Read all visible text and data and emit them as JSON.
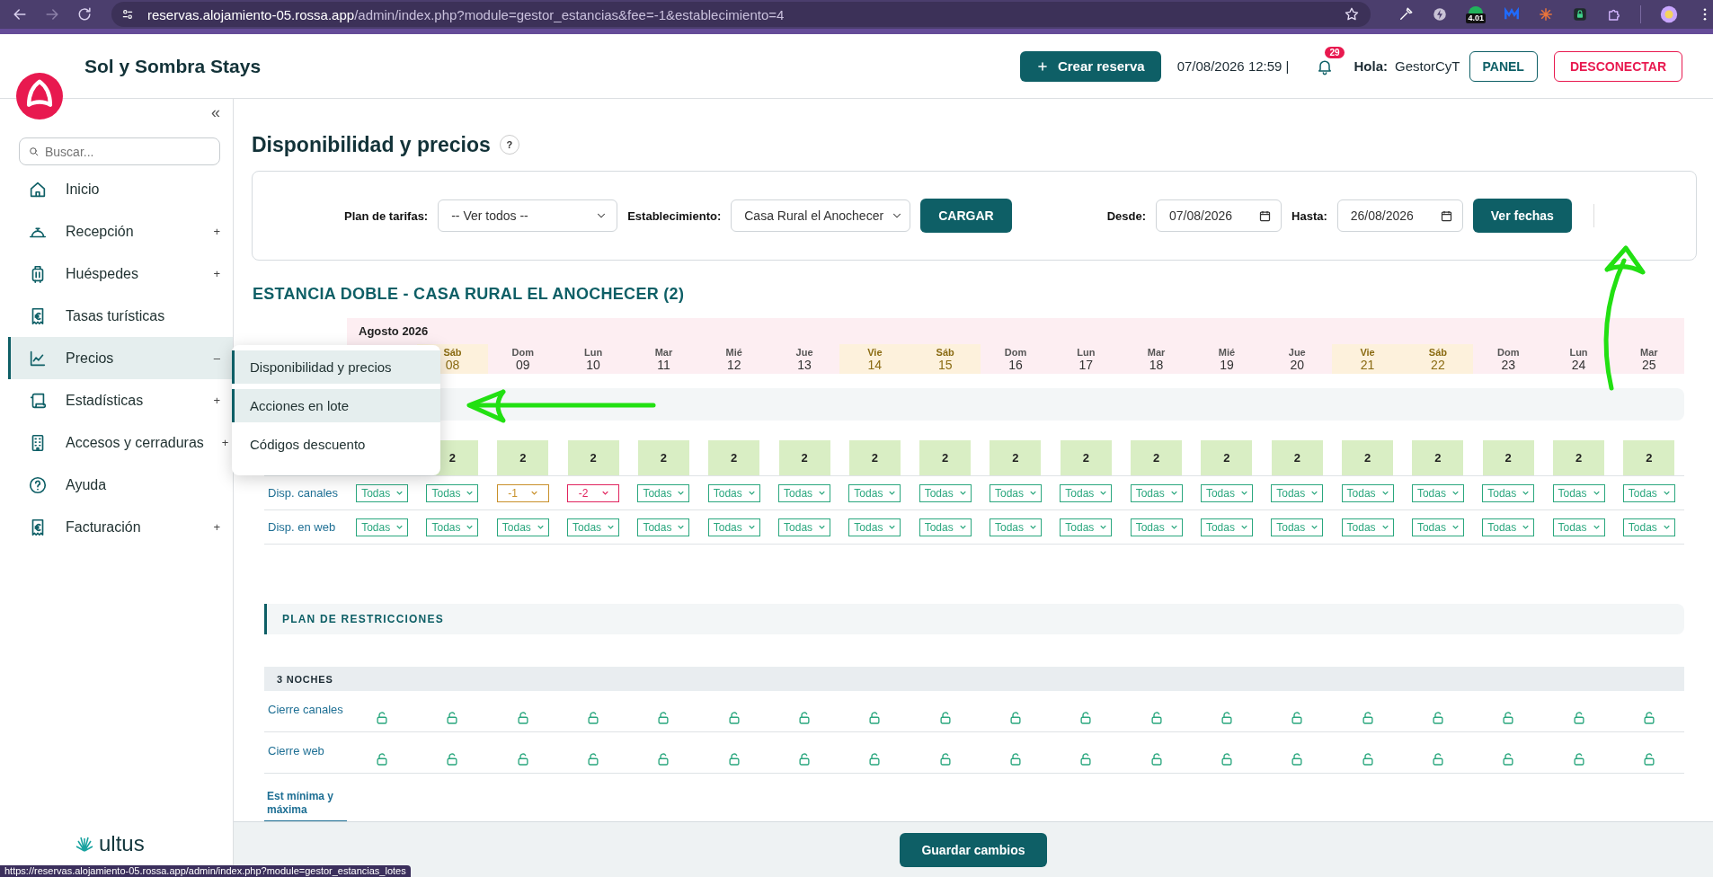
{
  "browser": {
    "address_host": "reservas.alojamiento-05.rossa.app",
    "address_path": "/admin/index.php?module=gestor_estancias&fee=-1&establecimiento=4",
    "extension_badge": "4.01",
    "link_preview": "https://reservas.alojamiento-05.rossa.app/admin/index.php?module=gestor_estancias_lotes"
  },
  "header": {
    "brand": "Sol y Sombra Stays",
    "create_button": "Crear reserva",
    "datetime": "07/08/2026 12:59 |",
    "notification_count": "29",
    "greeting": "Hola:",
    "user": "GestorCyT",
    "panel_button": "PANEL",
    "logout_button": "DESCONECTAR"
  },
  "sidebar": {
    "collapse": "«",
    "search_placeholder": "Buscar...",
    "footer_brand": "ultus",
    "items": [
      {
        "label": "Inicio",
        "selected": false
      },
      {
        "label": "Recepción",
        "toggle": "+",
        "selected": false
      },
      {
        "label": "Huéspedes",
        "toggle": "+",
        "selected": false
      },
      {
        "label": "Tasas turísticas",
        "selected": false
      },
      {
        "label": "Precios",
        "toggle": "–",
        "selected": true,
        "expanded": true,
        "children": [
          {
            "label": "Disponibilidad y precios",
            "highlighted": true
          },
          {
            "label": "Acciones en lote",
            "highlighted": true
          },
          {
            "label": "Códigos descuento",
            "highlighted": false
          }
        ]
      },
      {
        "label": "Estadísticas",
        "toggle": "+",
        "selected": false
      },
      {
        "label": "Accesos y cerraduras",
        "toggle": "+",
        "selected": false
      },
      {
        "label": "Ayuda",
        "selected": false
      },
      {
        "label": "Facturación",
        "toggle": "+",
        "selected": false
      }
    ]
  },
  "page": {
    "title": "Disponibilidad y precios",
    "help": "?"
  },
  "filters": {
    "rate_plan_label": "Plan de tarifas:",
    "rate_plan": "-- Ver todos --",
    "property_label": "Establecimiento:",
    "property": "Casa Rural el Anochecer",
    "load_button": "CARGAR",
    "from_label": "Desde:",
    "from": "07/08/2026",
    "to_label": "Hasta:",
    "to": "26/08/2026",
    "dates_button": "Ver fechas"
  },
  "stay": {
    "title": "ESTANCIA DOBLE - CASA RURAL EL ANOCHECER (2)",
    "month": "Agosto 2026",
    "channels_label": "Disp. canales",
    "web_label": "Disp. en web",
    "days": [
      {
        "channels": {
          "value": "Todas",
          "kind": "all"
        },
        "web": {
          "value": "Todas",
          "kind": "all"
        }
      },
      {
        "dow": "Sáb",
        "num": "08",
        "weekend": true,
        "avail": "2",
        "channels": {
          "value": "Todas",
          "kind": "all"
        },
        "web": {
          "value": "Todas",
          "kind": "all"
        }
      },
      {
        "dow": "Dom",
        "num": "09",
        "weekend": false,
        "avail": "2",
        "channels": {
          "value": "-1",
          "kind": "low"
        },
        "web": {
          "value": "Todas",
          "kind": "all"
        }
      },
      {
        "dow": "Lun",
        "num": "10",
        "weekend": false,
        "avail": "2",
        "channels": {
          "value": "-2",
          "kind": "negative"
        },
        "web": {
          "value": "Todas",
          "kind": "all"
        }
      },
      {
        "dow": "Mar",
        "num": "11",
        "weekend": false,
        "avail": "2",
        "channels": {
          "value": "Todas",
          "kind": "all"
        },
        "web": {
          "value": "Todas",
          "kind": "all"
        }
      },
      {
        "dow": "Mié",
        "num": "12",
        "weekend": false,
        "avail": "2",
        "channels": {
          "value": "Todas",
          "kind": "all"
        },
        "web": {
          "value": "Todas",
          "kind": "all"
        }
      },
      {
        "dow": "Jue",
        "num": "13",
        "weekend": false,
        "avail": "2",
        "channels": {
          "value": "Todas",
          "kind": "all"
        },
        "web": {
          "value": "Todas",
          "kind": "all"
        }
      },
      {
        "dow": "Vie",
        "num": "14",
        "weekend": true,
        "avail": "2",
        "channels": {
          "value": "Todas",
          "kind": "all"
        },
        "web": {
          "value": "Todas",
          "kind": "all"
        }
      },
      {
        "dow": "Sáb",
        "num": "15",
        "weekend": true,
        "avail": "2",
        "channels": {
          "value": "Todas",
          "kind": "all"
        },
        "web": {
          "value": "Todas",
          "kind": "all"
        }
      },
      {
        "dow": "Dom",
        "num": "16",
        "weekend": false,
        "avail": "2",
        "channels": {
          "value": "Todas",
          "kind": "all"
        },
        "web": {
          "value": "Todas",
          "kind": "all"
        }
      },
      {
        "dow": "Lun",
        "num": "17",
        "weekend": false,
        "avail": "2",
        "channels": {
          "value": "Todas",
          "kind": "all"
        },
        "web": {
          "value": "Todas",
          "kind": "all"
        }
      },
      {
        "dow": "Mar",
        "num": "18",
        "weekend": false,
        "avail": "2",
        "channels": {
          "value": "Todas",
          "kind": "all"
        },
        "web": {
          "value": "Todas",
          "kind": "all"
        }
      },
      {
        "dow": "Mié",
        "num": "19",
        "weekend": false,
        "avail": "2",
        "channels": {
          "value": "Todas",
          "kind": "all"
        },
        "web": {
          "value": "Todas",
          "kind": "all"
        }
      },
      {
        "dow": "Jue",
        "num": "20",
        "weekend": false,
        "avail": "2",
        "channels": {
          "value": "Todas",
          "kind": "all"
        },
        "web": {
          "value": "Todas",
          "kind": "all"
        }
      },
      {
        "dow": "Vie",
        "num": "21",
        "weekend": true,
        "avail": "2",
        "channels": {
          "value": "Todas",
          "kind": "all"
        },
        "web": {
          "value": "Todas",
          "kind": "all"
        }
      },
      {
        "dow": "Sáb",
        "num": "22",
        "weekend": true,
        "avail": "2",
        "channels": {
          "value": "Todas",
          "kind": "all"
        },
        "web": {
          "value": "Todas",
          "kind": "all"
        }
      },
      {
        "dow": "Dom",
        "num": "23",
        "weekend": false,
        "avail": "2",
        "channels": {
          "value": "Todas",
          "kind": "all"
        },
        "web": {
          "value": "Todas",
          "kind": "all"
        }
      },
      {
        "dow": "Lun",
        "num": "24",
        "weekend": false,
        "avail": "2",
        "channels": {
          "value": "Todas",
          "kind": "all"
        },
        "web": {
          "value": "Todas",
          "kind": "all"
        }
      },
      {
        "dow": "Mar",
        "num": "25",
        "weekend": false,
        "avail": "2",
        "channels": {
          "value": "Todas",
          "kind": "all"
        },
        "web": {
          "value": "Todas",
          "kind": "all"
        }
      }
    ]
  },
  "restrictions": {
    "title": "PLAN DE RESTRICCIONES",
    "group": "3 NOCHES",
    "rows": [
      {
        "label": "Cierre canales",
        "locked": [
          false,
          false,
          false,
          false,
          false,
          false,
          false,
          false,
          false,
          false,
          false,
          false,
          false,
          false,
          false,
          false,
          false,
          false,
          false
        ]
      },
      {
        "label": "Cierre web",
        "locked": [
          false,
          false,
          false,
          false,
          false,
          false,
          false,
          false,
          false,
          false,
          false,
          false,
          false,
          false,
          false,
          false,
          false,
          false,
          false
        ]
      }
    ],
    "tab": {
      "label": "Est mínima y máxima",
      "selected": true
    }
  },
  "footer": {
    "save_button": "Guardar cambios"
  }
}
